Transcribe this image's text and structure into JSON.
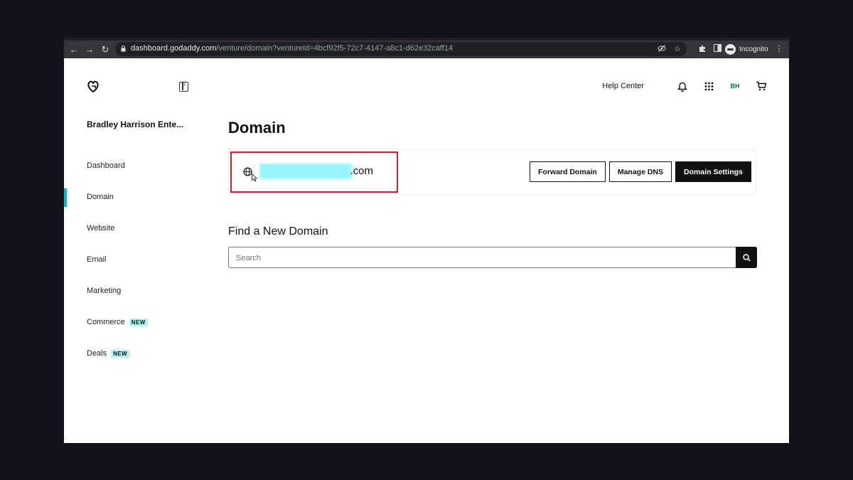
{
  "browser": {
    "url_host": "dashboard.godaddy.com",
    "url_path": "/venture/domain?ventureId=4bcf92f5-72c7-4147-a8c1-d62e32caff14",
    "profile_label": "Incognito"
  },
  "header": {
    "help_label": "Help Center",
    "avatar_initials": "BH"
  },
  "sidebar": {
    "venture_name": "Bradley Harrison Ente...",
    "items": [
      {
        "label": "Dashboard",
        "badge": ""
      },
      {
        "label": "Domain",
        "badge": "",
        "active": true
      },
      {
        "label": "Website",
        "badge": ""
      },
      {
        "label": "Email",
        "badge": ""
      },
      {
        "label": "Marketing",
        "badge": ""
      },
      {
        "label": "Commerce",
        "badge": "NEW"
      },
      {
        "label": "Deals",
        "badge": "NEW"
      }
    ]
  },
  "main": {
    "title": "Domain",
    "domain_suffix": ".com",
    "buttons": {
      "forward": "Forward Domain",
      "dns": "Manage DNS",
      "settings": "Domain Settings"
    },
    "find_title": "Find a New Domain",
    "search_placeholder": "Search"
  },
  "colors": {
    "accent": "#09b8c4",
    "highlight_box": "#cc1f2b",
    "badge_bg": "#b3f3f6"
  }
}
